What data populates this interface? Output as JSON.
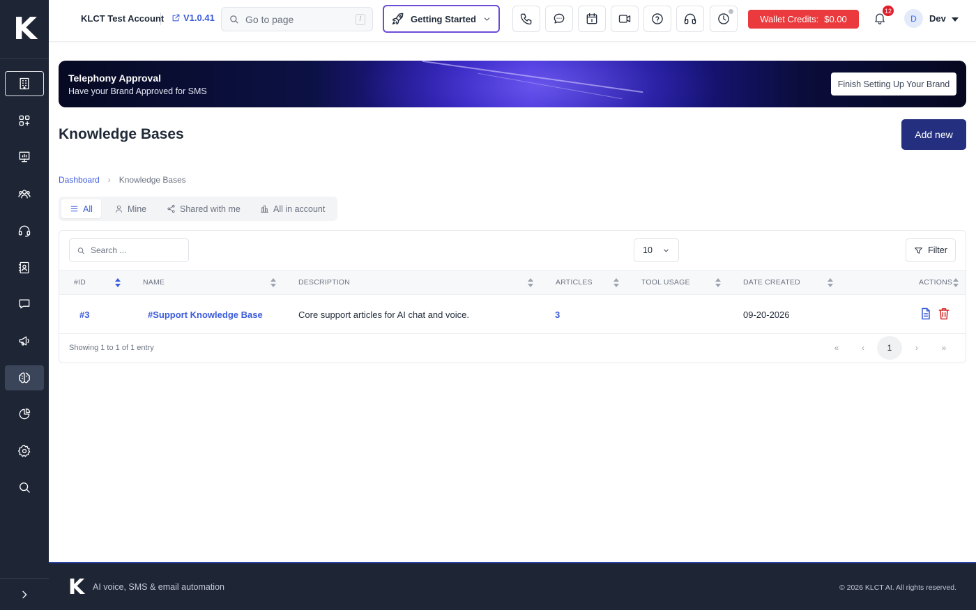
{
  "sidebar": {
    "logo": "K",
    "items": [
      {
        "name": "building",
        "icon": "building-icon"
      },
      {
        "name": "apps",
        "icon": "apps-plus-icon"
      },
      {
        "name": "presentation",
        "icon": "presentation-icon"
      },
      {
        "name": "team",
        "icon": "team-icon"
      },
      {
        "name": "support",
        "icon": "headset-icon"
      },
      {
        "name": "contacts",
        "icon": "contact-book-icon"
      },
      {
        "name": "chat",
        "icon": "chat-bubble-icon"
      },
      {
        "name": "campaigns",
        "icon": "megaphone-icon"
      },
      {
        "name": "knowledge",
        "icon": "brain-icon",
        "active": true
      },
      {
        "name": "reports",
        "icon": "pie-chart-icon"
      },
      {
        "name": "settings",
        "icon": "gear-icon"
      },
      {
        "name": "search",
        "icon": "search-icon"
      }
    ],
    "expand_icon": "chevron-right-icon"
  },
  "topbar": {
    "account": "KLCT Test Account",
    "version": "V1.0.41",
    "goto_placeholder": "Go to page",
    "goto_shortcut": "/",
    "getting_started": "Getting Started",
    "icon_buttons": [
      "phone-icon",
      "chat-icon",
      "calendar-icon",
      "video-icon",
      "help-icon",
      "headset-icon",
      "clock-icon"
    ],
    "wallet_label": "Wallet Credits:",
    "wallet_value": "$0.00",
    "notifications": "12",
    "avatar_initial": "D",
    "user_name": "Dev"
  },
  "banner": {
    "title": "Telephony Approval",
    "subtitle": "Have your Brand Approved for SMS",
    "button": "Finish Setting Up Your Brand"
  },
  "page": {
    "title": "Knowledge Bases",
    "add_button": "Add new",
    "breadcrumb": {
      "root": "Dashboard",
      "current": "Knowledge Bases"
    }
  },
  "tabs": [
    {
      "label": "All",
      "icon": "list-icon",
      "active": true
    },
    {
      "label": "Mine",
      "icon": "user-icon"
    },
    {
      "label": "Shared with me",
      "icon": "share-icon"
    },
    {
      "label": "All in account",
      "icon": "building-icon"
    }
  ],
  "table": {
    "search_placeholder": "Search ...",
    "per_page": "10",
    "filter_label": "Filter",
    "columns": [
      "#ID",
      "NAME",
      "DESCRIPTION",
      "ARTICLES",
      "TOOL USAGE",
      "DATE CREATED",
      "ACTIONS"
    ],
    "rows": [
      {
        "id": "#3",
        "name": "#Support Knowledge Base",
        "description": "Core support articles for AI chat and voice.",
        "articles": "3",
        "tool_usage": "",
        "date_created": "09-20-2026"
      }
    ],
    "showing": "Showing 1 to 1 of 1 entry",
    "pagination": {
      "first": "«",
      "prev": "‹",
      "current": "1",
      "next": "›",
      "last": "»"
    }
  },
  "footer": {
    "logo": "K",
    "tagline": "AI voice, SMS & email automation",
    "copyright": "© 2026 KLCT AI. All rights reserved."
  },
  "colors": {
    "sidebar_bg": "#1e2535",
    "accent_blue": "#3b5bdb",
    "primary_button": "#24307f",
    "wallet_red": "#ea3a3d",
    "delete_red": "#d62828",
    "getting_started_border": "#6d4cd8"
  }
}
